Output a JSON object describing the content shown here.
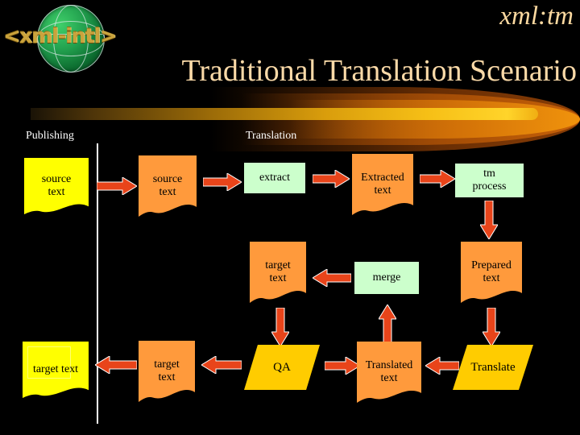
{
  "slide": {
    "brand": "<xml-intl>",
    "brand_mark": "xml:tm",
    "title": "Traditional Translation Scenario",
    "logo_icon": "globe-icon",
    "swoosh_icon": "swoosh-decoration",
    "colors": {
      "background": "#000000",
      "title": "#fbdaa8",
      "accent_gold": "#ffd42a",
      "arrow": "#e8441a",
      "doc_yellow": "#ffff00",
      "doc_orange": "#ff9a3c",
      "process_green": "#ccffcc",
      "parallelogram_gold": "#ffcc00",
      "divider": "#ffffff"
    }
  },
  "sections": [
    {
      "id": "publishing",
      "label": "Publishing"
    },
    {
      "id": "translation",
      "label": "Translation"
    }
  ],
  "diagram": {
    "type": "flowchart",
    "nodes": [
      {
        "id": "n1",
        "label": "source\ntext",
        "line1": "source",
        "line2": "text",
        "shape": "document",
        "color": "#ffff00",
        "row": 1,
        "col": 1
      },
      {
        "id": "n2",
        "label": "source\ntext",
        "line1": "source",
        "line2": "text",
        "shape": "document",
        "color": "#ff9a3c",
        "row": 1,
        "col": 2
      },
      {
        "id": "n3",
        "label": "extract",
        "line1": "extract",
        "line2": "",
        "shape": "process",
        "color": "#ccffcc",
        "row": 1,
        "col": 3
      },
      {
        "id": "n4",
        "label": "Extracted\ntext",
        "line1": "Extracted",
        "line2": "text",
        "shape": "document",
        "color": "#ff9a3c",
        "row": 1,
        "col": 4
      },
      {
        "id": "n5",
        "label": "tm\nprocess",
        "line1": "tm",
        "line2": "process",
        "shape": "process",
        "color": "#ccffcc",
        "row": 1,
        "col": 5
      },
      {
        "id": "n6",
        "label": "target\ntext",
        "line1": "target",
        "line2": "text",
        "shape": "document",
        "color": "#ff9a3c",
        "row": 2,
        "col": 3
      },
      {
        "id": "n7",
        "label": "merge",
        "line1": "merge",
        "line2": "",
        "shape": "process",
        "color": "#ccffcc",
        "row": 2,
        "col": 4
      },
      {
        "id": "n8",
        "label": "Prepared\ntext",
        "line1": "Prepared",
        "line2": "text",
        "shape": "document",
        "color": "#ff9a3c",
        "row": 2,
        "col": 5
      },
      {
        "id": "n9",
        "label": "target text",
        "line1": "target text",
        "line2": "",
        "shape": "document",
        "color": "#ffff00",
        "row": 3,
        "col": 1
      },
      {
        "id": "n10",
        "label": "target\ntext",
        "line1": "target",
        "line2": "text",
        "shape": "document",
        "color": "#ff9a3c",
        "row": 3,
        "col": 2
      },
      {
        "id": "n11",
        "label": "QA",
        "line1": "QA",
        "line2": "",
        "shape": "parallelogram",
        "color": "#ffcc00",
        "row": 3,
        "col": 3
      },
      {
        "id": "n12",
        "label": "Translated\ntext",
        "line1": "Translated",
        "line2": "text",
        "shape": "document",
        "color": "#ff9a3c",
        "row": 3,
        "col": 4
      },
      {
        "id": "n13",
        "label": "Translate",
        "line1": "Translate",
        "line2": "",
        "shape": "parallelogram",
        "color": "#ffcc00",
        "row": 3,
        "col": 5
      }
    ],
    "edges": [
      {
        "from": "n1",
        "to": "n2",
        "dir": "right"
      },
      {
        "from": "n2",
        "to": "n3",
        "dir": "right"
      },
      {
        "from": "n3",
        "to": "n4",
        "dir": "right"
      },
      {
        "from": "n4",
        "to": "n5",
        "dir": "right"
      },
      {
        "from": "n5",
        "to": "n8",
        "dir": "down"
      },
      {
        "from": "n8",
        "to": "n13",
        "dir": "down"
      },
      {
        "from": "n13",
        "to": "n12",
        "dir": "left"
      },
      {
        "from": "n12",
        "to": "n7",
        "dir": "up"
      },
      {
        "from": "n7",
        "to": "n6",
        "dir": "left"
      },
      {
        "from": "n6",
        "to": "n11",
        "dir": "down"
      },
      {
        "from": "n11",
        "to": "n10",
        "dir": "left"
      },
      {
        "from": "n10",
        "to": "n9",
        "dir": "left"
      }
    ]
  }
}
